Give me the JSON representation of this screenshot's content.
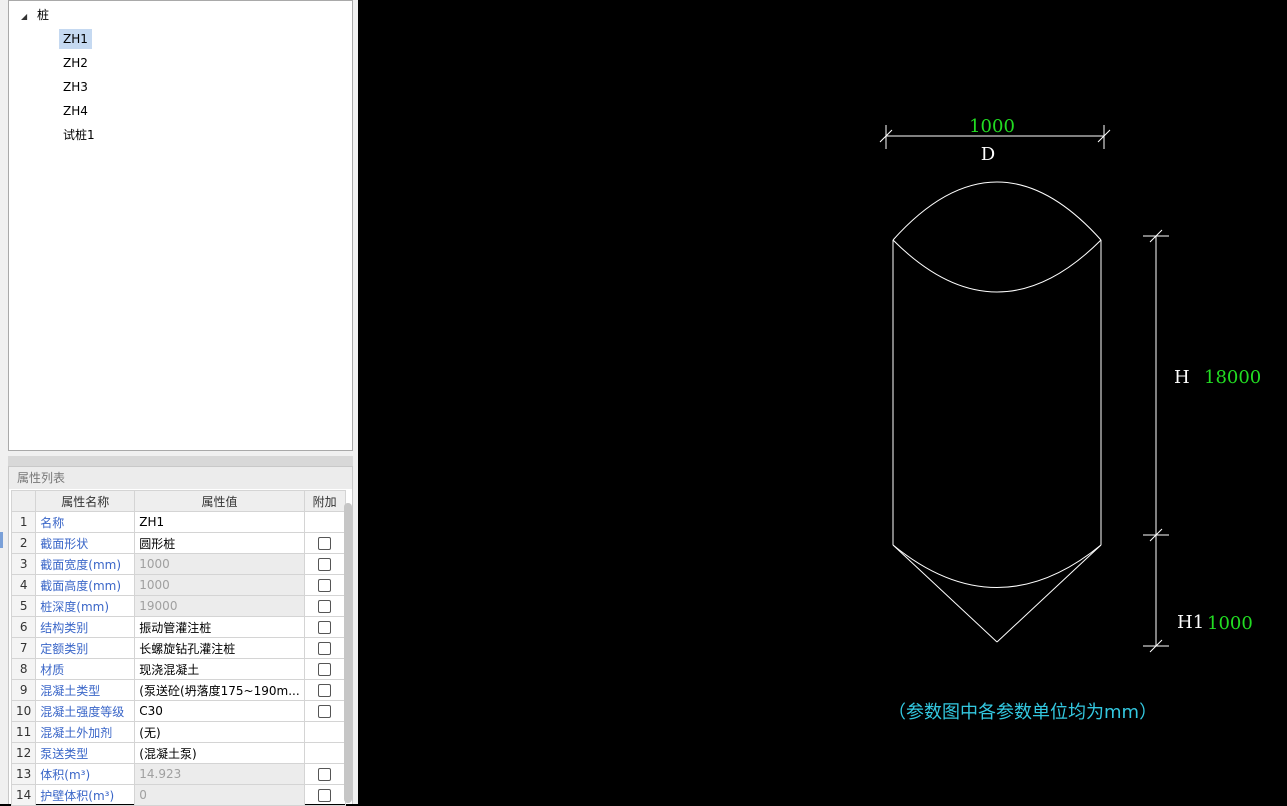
{
  "tree": {
    "root": "桩",
    "items": [
      "ZH1",
      "ZH2",
      "ZH3",
      "ZH4",
      "试桩1"
    ],
    "selected": "ZH1"
  },
  "props": {
    "title": "属性列表",
    "headers": [
      "属性名称",
      "属性值",
      "附加"
    ],
    "rows": [
      {
        "n": "1",
        "name": "名称",
        "value": "ZH1",
        "ro": false,
        "cb": false
      },
      {
        "n": "2",
        "name": "截面形状",
        "value": "圆形桩",
        "ro": false,
        "cb": true
      },
      {
        "n": "3",
        "name": "截面宽度(mm)",
        "value": "1000",
        "ro": true,
        "cb": true
      },
      {
        "n": "4",
        "name": "截面高度(mm)",
        "value": "1000",
        "ro": true,
        "cb": true
      },
      {
        "n": "5",
        "name": "桩深度(mm)",
        "value": "19000",
        "ro": true,
        "cb": true
      },
      {
        "n": "6",
        "name": "结构类别",
        "value": "振动管灌注桩",
        "ro": false,
        "cb": true
      },
      {
        "n": "7",
        "name": "定额类别",
        "value": "长螺旋钻孔灌注桩",
        "ro": false,
        "cb": true
      },
      {
        "n": "8",
        "name": "材质",
        "value": "现浇混凝土",
        "ro": false,
        "cb": true
      },
      {
        "n": "9",
        "name": "混凝土类型",
        "value": "(泵送砼(坍落度175~190m...",
        "ro": false,
        "cb": true
      },
      {
        "n": "10",
        "name": "混凝土强度等级",
        "value": "C30",
        "ro": false,
        "cb": true
      },
      {
        "n": "11",
        "name": "混凝土外加剂",
        "value": "(无)",
        "ro": false,
        "cb": false
      },
      {
        "n": "12",
        "name": "泵送类型",
        "value": "(混凝土泵)",
        "ro": false,
        "cb": false
      },
      {
        "n": "13",
        "name": "体积(m³)",
        "value": "14.923",
        "ro": true,
        "cb": true
      },
      {
        "n": "14",
        "name": "护壁体积(m³)",
        "value": "0",
        "ro": true,
        "cb": true
      }
    ]
  },
  "drawing": {
    "d_value": "1000",
    "d_label": "D",
    "h_label": "H",
    "h_value": "18000",
    "h1_label": "H1",
    "h1_value": "1000",
    "note": "（参数图中各参数单位均为mm）"
  },
  "colors": {
    "value_green": "#22dd22",
    "note_cyan": "#33c8e0",
    "name_blue": "#3a66c8",
    "line_white": "#ffffff"
  }
}
